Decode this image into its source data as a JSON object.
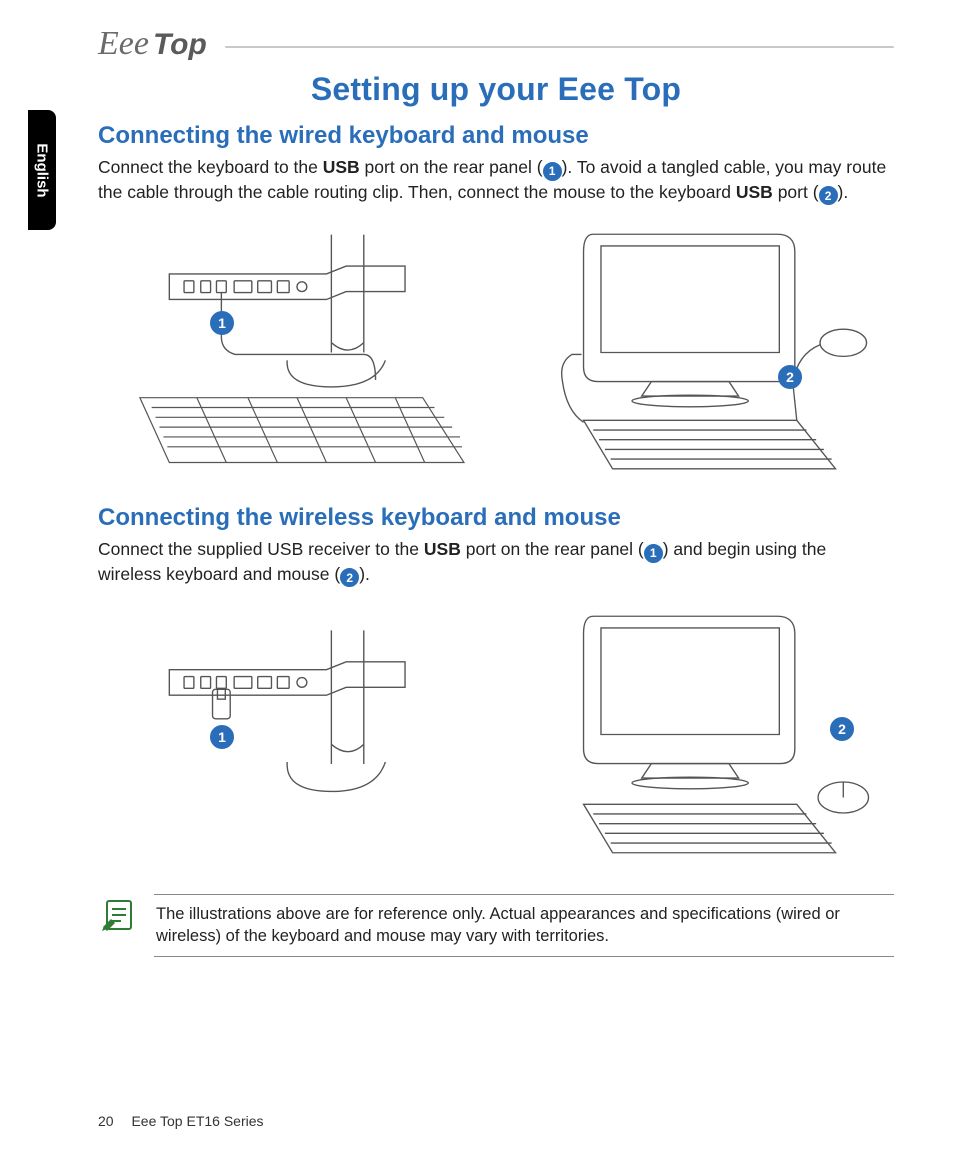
{
  "logo": {
    "script": "Eee",
    "word": "Top"
  },
  "language_tab": "English",
  "title": "Setting up your Eee Top",
  "section1": {
    "heading": "Connecting the wired keyboard and mouse",
    "p1a": "Connect the keyboard to the ",
    "p1b_bold": "USB",
    "p1c": " port on the rear panel (",
    "p1d": "). To avoid a tangled cable, you may route the cable through the cable routing clip. Then, connect the mouse to the keyboard ",
    "p1e_bold": "USB",
    "p1f": " port (",
    "p1g": ").",
    "callout1": "1",
    "callout2": "2"
  },
  "section2": {
    "heading": "Connecting the wireless keyboard and mouse",
    "p1a": "Connect the supplied USB receiver to the ",
    "p1b_bold": "USB",
    "p1c": " port on the rear panel (",
    "p1d": ") and begin using the wireless keyboard and mouse (",
    "p1e": ").",
    "callout1": "1",
    "callout2": "2"
  },
  "note": "The illustrations above are for reference only. Actual appearances and specifications (wired or wireless) of the keyboard and mouse may vary with territories.",
  "footer": {
    "page": "20",
    "product": "Eee Top ET16 Series"
  }
}
